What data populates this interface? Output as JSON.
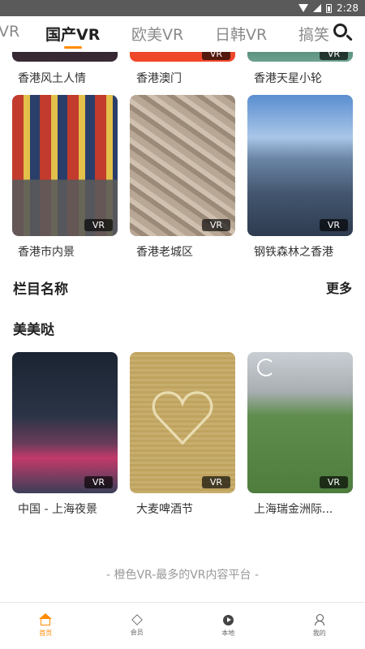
{
  "status_bar": {
    "time": "2:28"
  },
  "tabs": [
    {
      "label": "VR"
    },
    {
      "label": "国产VR"
    },
    {
      "label": "欧美VR"
    },
    {
      "label": "日韩VR"
    },
    {
      "label": "搞笑"
    }
  ],
  "active_tab": "国产VR",
  "accent_color": "#ff8a00",
  "grid_top": [
    {
      "caption": "香港风土人情",
      "badge": "VR"
    },
    {
      "caption": "香港澳门",
      "badge": "VR"
    },
    {
      "caption": "香港天星小轮",
      "badge": "VR"
    }
  ],
  "grid_hk": [
    {
      "caption": "香港市内景",
      "badge": "VR"
    },
    {
      "caption": "香港老城区",
      "badge": "VR"
    },
    {
      "caption": "钢铁森林之香港",
      "badge": "VR"
    }
  ],
  "section": {
    "title": "栏目名称",
    "more": "更多"
  },
  "subsection": {
    "title": "美美哒"
  },
  "grid_mm": [
    {
      "caption": "中国 - 上海夜景",
      "badge": "VR"
    },
    {
      "caption": "大麦啤酒节",
      "badge": "VR"
    },
    {
      "caption": "上海瑞金洲际...",
      "badge": "VR"
    }
  ],
  "footer": "- 橙色VR-最多的VR内容平台 -",
  "bottom_nav": [
    {
      "label": "首页",
      "icon": "home-icon"
    },
    {
      "label": "会员",
      "icon": "diamond-icon"
    },
    {
      "label": "本地",
      "icon": "play-icon"
    },
    {
      "label": "我的",
      "icon": "user-icon"
    }
  ]
}
